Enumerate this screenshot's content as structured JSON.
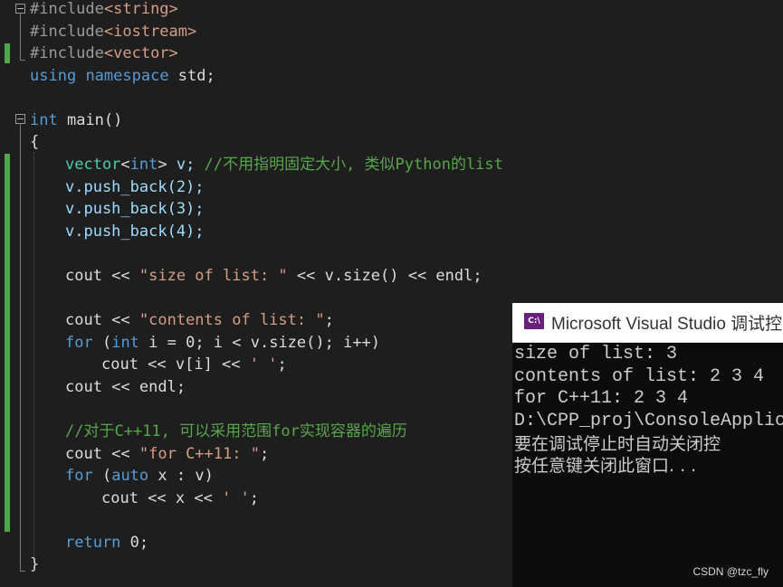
{
  "editor": {
    "lines": {
      "l1": {
        "a": "#include",
        "b": "<string>"
      },
      "l2": {
        "a": "#include",
        "b": "<iostream>"
      },
      "l3": {
        "a": "#include",
        "b": "<vector>"
      },
      "l4": {
        "a": "using",
        "b": " ",
        "c": "namespace",
        "d": " std;"
      },
      "l6": {
        "a": "int",
        "b": " main()"
      },
      "l7": {
        "a": "{"
      },
      "l8": {
        "a": "vector",
        "b": "<",
        "c": "int",
        "d": ">",
        "e": " v; ",
        "f": "//不用指明固定大小, 类似Python的list"
      },
      "l9": {
        "a": "v.push_back(2);"
      },
      "l10": {
        "a": "v.push_back(3);"
      },
      "l11": {
        "a": "v.push_back(4);"
      },
      "l13": {
        "a": "cout << ",
        "b": "\"size of list: \"",
        "c": " << v.size() << endl;"
      },
      "l15": {
        "a": "cout << ",
        "b": "\"contents of list: \"",
        "c": ";"
      },
      "l16": {
        "a": "for",
        "b": " (",
        "c": "int",
        "d": " i = 0; i < v.size(); i++)"
      },
      "l17": {
        "a": "cout << v[i] << ",
        "b": "' '",
        "c": ";"
      },
      "l18": {
        "a": "cout << endl;"
      },
      "l20": {
        "a": "//对于C++11, 可以采用范围for实现容器的遍历"
      },
      "l21": {
        "a": "cout << ",
        "b": "\"for C++11: \"",
        "c": ";"
      },
      "l22": {
        "a": "for",
        "b": " (",
        "c": "auto",
        "d": " x : v)"
      },
      "l23": {
        "a": "cout << x << ",
        "b": "' '",
        "c": ";"
      },
      "l25": {
        "a": "return",
        "b": " 0;"
      },
      "l26": {
        "a": "}"
      }
    }
  },
  "console": {
    "title": "Microsoft Visual Studio 调试控",
    "icon_text": "C:\\",
    "output": [
      "size of list: 3",
      "contents of list: 2 3 4",
      "for C++11: 2 3 4",
      "D:\\CPP_proj\\ConsoleApplic",
      "要在调试停止时自动关闭控",
      "按任意键关闭此窗口. . ."
    ]
  },
  "watermark": "CSDN @tzc_fly",
  "colors": {
    "keyword": "#569cd6",
    "type": "#4ec9b0",
    "string": "#d69d85",
    "comment": "#57a64a",
    "change_bar": "#4ea64a"
  }
}
